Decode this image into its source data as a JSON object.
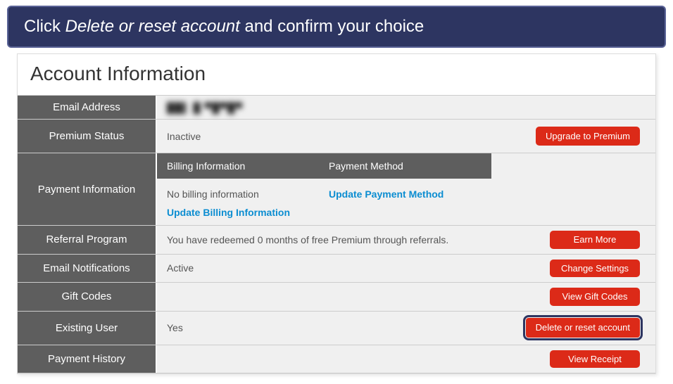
{
  "banner": {
    "prefix": "Click ",
    "emphasis": "Delete or reset account",
    "suffix": " and confirm your choice"
  },
  "page_title": "Account Information",
  "rows": {
    "email": {
      "label": "Email Address",
      "value": "██▌ █  ▀█▀█▀"
    },
    "premium": {
      "label": "Premium Status",
      "value": "Inactive",
      "button": "Upgrade to Premium"
    },
    "payment": {
      "label": "Payment Information",
      "billing_header": "Billing Information",
      "method_header": "Payment Method",
      "no_billing": "No billing information",
      "update_billing": "Update Billing Information",
      "update_method": "Update Payment Method"
    },
    "referral": {
      "label": "Referral Program",
      "value": "You have redeemed 0 months of free Premium through referrals.",
      "button": "Earn More"
    },
    "notifications": {
      "label": "Email Notifications",
      "value": "Active",
      "button": "Change Settings"
    },
    "gift": {
      "label": "Gift Codes",
      "value": "",
      "button": "View Gift Codes"
    },
    "existing": {
      "label": "Existing User",
      "value": "Yes",
      "button": "Delete or reset account"
    },
    "history": {
      "label": "Payment History",
      "value": "",
      "button": "View Receipt"
    }
  }
}
